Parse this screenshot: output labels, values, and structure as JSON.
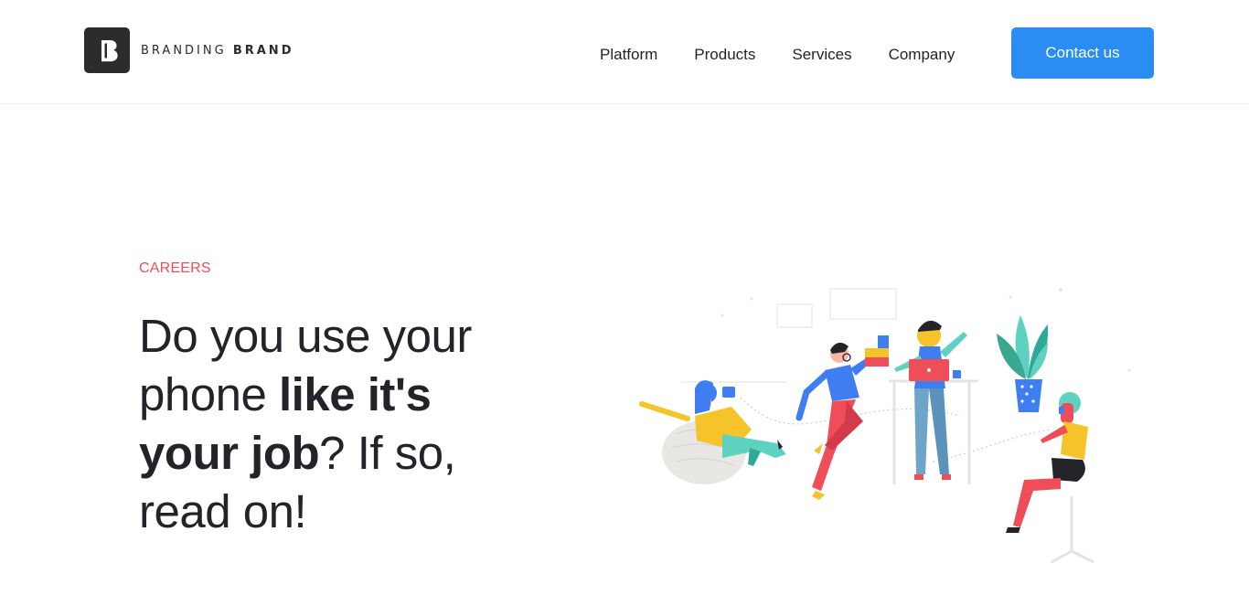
{
  "brand": {
    "name_light": "BRANDING",
    "name_bold": "BRAND",
    "logo_letter": "B"
  },
  "nav": {
    "items": [
      "Platform",
      "Products",
      "Services",
      "Company"
    ]
  },
  "header": {
    "cta_label": "Contact us"
  },
  "hero": {
    "eyebrow": "CAREERS",
    "headline_part1": "Do you use your phone ",
    "headline_bold1": "like it's",
    "headline_bold2": "your job",
    "headline_part2": "? If so, read on!"
  },
  "colors": {
    "accent": "#2a8df4",
    "eyebrow": "#ef4d58",
    "text": "#23232a",
    "logo": "#2c2b2e"
  },
  "icons": {
    "logo": "branding-brand-logo-icon",
    "illustration": "team-working-illustration"
  }
}
